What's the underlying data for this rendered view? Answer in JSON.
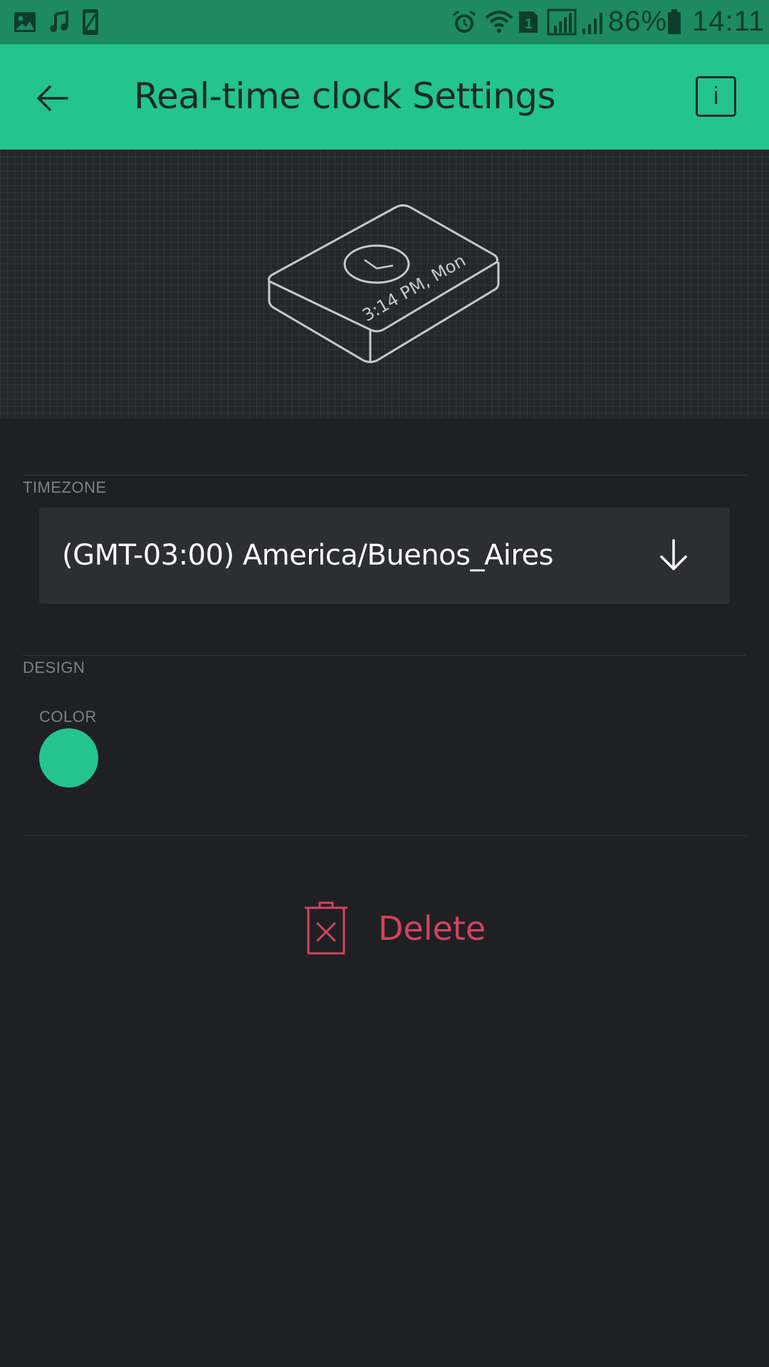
{
  "status_bar": {
    "battery": "86%",
    "time": "14:11",
    "icons": [
      "image-icon",
      "music-icon",
      "phone-icon",
      "alarm-icon",
      "wifi-icon",
      "sim-1-icon",
      "signal-icon",
      "signal-icon",
      "battery-icon"
    ]
  },
  "app_bar": {
    "title": "Real-time clock Settings",
    "back_icon": "arrow-left-icon",
    "info_label": "i"
  },
  "preview": {
    "device_text": "3:14 PM, Mon"
  },
  "timezone": {
    "section_label": "TIMEZONE",
    "selected": "(GMT-03:00) America/Buenos_Aires",
    "arrow_icon": "arrow-down-icon"
  },
  "design": {
    "section_label": "DESIGN",
    "color_label": "COLOR",
    "color_value": "#23c48e"
  },
  "actions": {
    "delete_label": "Delete",
    "delete_color": "#d3435c"
  },
  "colors": {
    "accent": "#23c48e",
    "status_bar": "#1d8a62",
    "background": "#1f2024",
    "danger": "#d3435c"
  }
}
